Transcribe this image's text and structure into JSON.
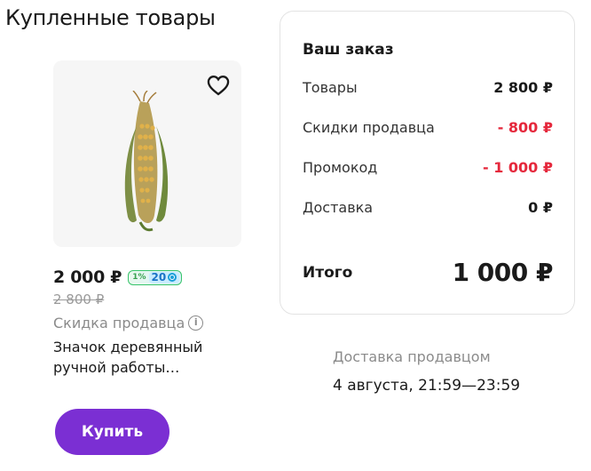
{
  "page": {
    "title": "Купленные товары"
  },
  "product": {
    "price": "2 000 ₽",
    "bonus_percent": "1%",
    "bonus_value": "20",
    "old_price": "2 800 ₽",
    "discount_label": "Скидка продавца",
    "name_line1": "Значок деревянный",
    "name_line2": "ручной работы…",
    "favorite_icon": "heart-icon",
    "info_icon": "info-icon"
  },
  "buy_button": {
    "label": "Купить"
  },
  "order": {
    "title": "Ваш заказ",
    "rows": [
      {
        "label": "Товары",
        "value": "2 800 ₽"
      },
      {
        "label": "Скидки продавца",
        "value": "- 800 ₽"
      },
      {
        "label": "Промокод",
        "value": "- 1 000 ₽"
      },
      {
        "label": "Доставка",
        "value": "0 ₽"
      }
    ],
    "total_label": "Итого",
    "total_value": "1 000 ₽"
  },
  "delivery": {
    "label": "Доставка продавцом",
    "time": "4 августа, 21:59—23:59"
  },
  "colors": {
    "accent": "#7b2fd3",
    "discount_red": "#e5283c",
    "bonus_green": "#37c46a",
    "bonus_blue": "#1a73c6"
  }
}
